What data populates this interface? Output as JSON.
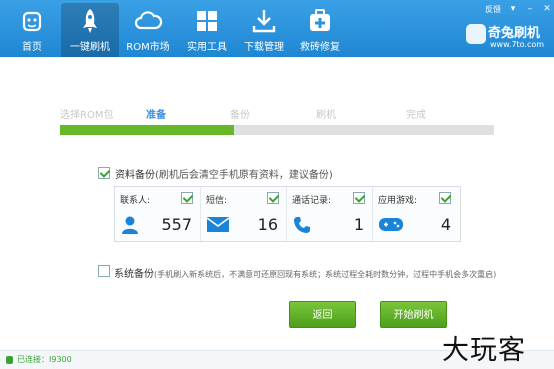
{
  "window": {
    "feedback": "反馈"
  },
  "nav": [
    {
      "label": "首页",
      "icon": "android-icon"
    },
    {
      "label": "一键刷机",
      "icon": "rocket-icon"
    },
    {
      "label": "ROM市场",
      "icon": "cloud-icon"
    },
    {
      "label": "实用工具",
      "icon": "grid-icon"
    },
    {
      "label": "下载管理",
      "icon": "download-icon"
    },
    {
      "label": "救砖修复",
      "icon": "medkit-icon"
    }
  ],
  "brand": {
    "name": "奇兔刷机",
    "url": "www.7to.com"
  },
  "steps": {
    "items": [
      "选择ROM包",
      "准备",
      "备份",
      "刷机",
      "完成"
    ],
    "current_index": 1,
    "progress_fraction": 0.4
  },
  "data_backup": {
    "checked": true,
    "title": "资料备份",
    "hint": "(刷机后会清空手机原有资料，建议备份)",
    "items": [
      {
        "label": "联系人:",
        "count": "557",
        "icon": "contact-icon",
        "checked": true
      },
      {
        "label": "短信:",
        "count": "16",
        "icon": "envelope-icon",
        "checked": true
      },
      {
        "label": "通话记录:",
        "count": "1",
        "icon": "phone-icon",
        "checked": true
      },
      {
        "label": "应用游戏:",
        "count": "4",
        "icon": "gamepad-icon",
        "checked": true
      }
    ]
  },
  "system_backup": {
    "checked": false,
    "title": "系统备份",
    "note": "(手机刷入新系统后，不满意可还原回现有系统；系统过程全耗时数分钟，过程中手机会多次重启)"
  },
  "buttons": {
    "back": "返回",
    "start": "开始刷机"
  },
  "status": {
    "connection": "已连接：I9300"
  },
  "watermark": "大玩客",
  "colors": {
    "header": "#2a93dd",
    "progress": "#67b72a",
    "button": "#5fb028",
    "accent": "#3a8ee6"
  }
}
